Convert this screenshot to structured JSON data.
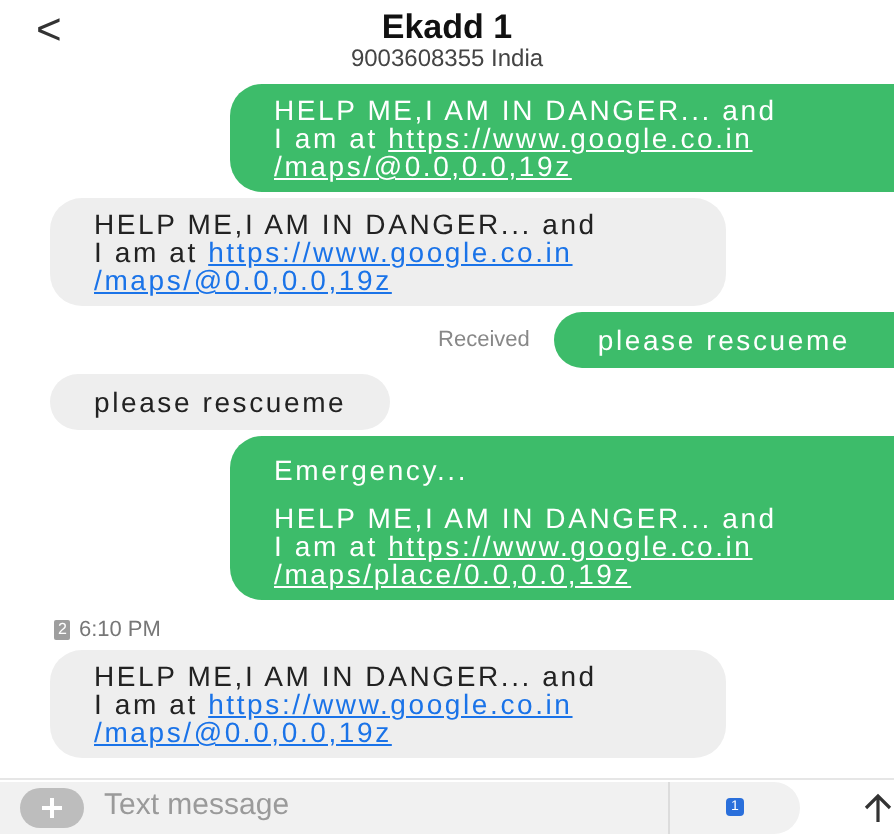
{
  "header": {
    "back": "<",
    "title": "Ekadd 1",
    "subtitle": "9003608355 India"
  },
  "messages": [
    {
      "kind": "outgoing",
      "lines": [
        {
          "text": "HELP ME,I AM IN DANGER... and"
        },
        {
          "text": "I am at ",
          "link": "https://www.google.co.in"
        },
        {
          "link": "/maps/@0.0,0.0,19z"
        }
      ]
    },
    {
      "kind": "incoming",
      "lines": [
        {
          "text": "HELP ME,I AM IN DANGER... and"
        },
        {
          "text": "I am at ",
          "link": "https://www.google.co.in"
        },
        {
          "link": "/maps/@0.0,0.0,19z"
        }
      ]
    },
    {
      "kind": "outgoing",
      "status": "Received",
      "lines": [
        {
          "text": "please rescueme"
        }
      ]
    },
    {
      "kind": "incoming",
      "lines": [
        {
          "text": "please rescueme"
        }
      ]
    },
    {
      "kind": "outgoing",
      "heading": "Emergency...",
      "lines": [
        {
          "text": "HELP ME,I AM IN DANGER... and"
        },
        {
          "text": "I am at ",
          "link": "https://www.google.co.in"
        },
        {
          "link": "/maps/place/0.0,0.0,19z"
        }
      ]
    },
    {
      "kind": "incoming",
      "sim": "2",
      "time": "6:10 PM",
      "lines": [
        {
          "text": "HELP ME,I AM IN DANGER... and"
        },
        {
          "text": "I am at ",
          "link": "https://www.google.co.in"
        },
        {
          "link": "/maps/@0.0,0.0,19z"
        }
      ]
    }
  ],
  "composer": {
    "placeholder": "Text message",
    "sim": "1"
  }
}
